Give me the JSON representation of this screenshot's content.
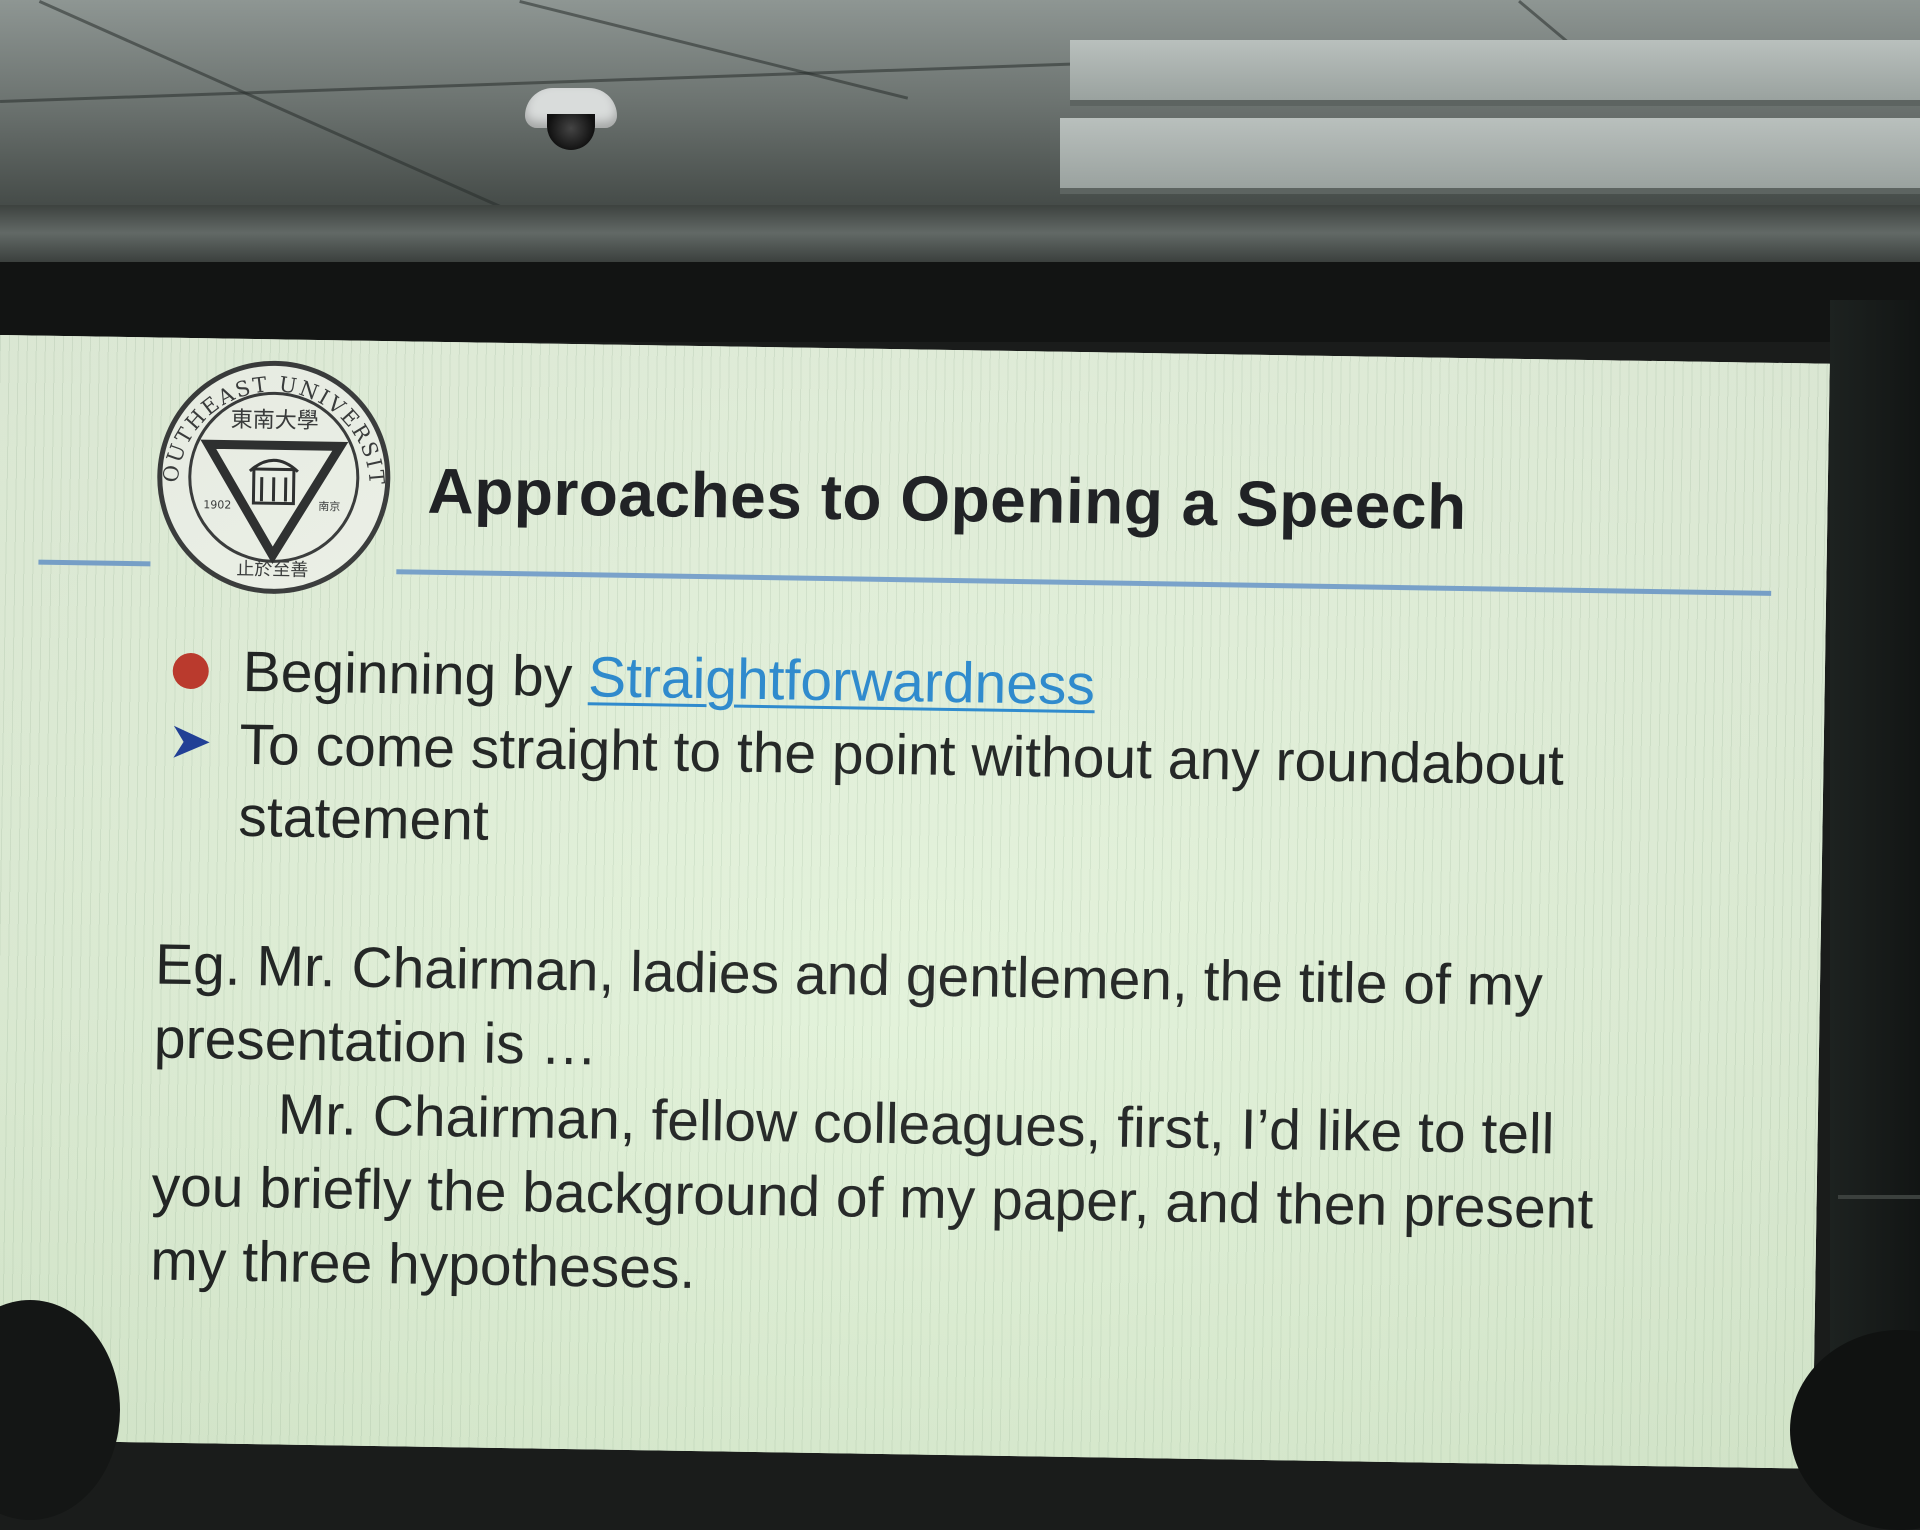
{
  "slide": {
    "title": "Approaches to Opening a Speech",
    "bullet": {
      "lead": "Beginning by ",
      "link": "Straightforwardness"
    },
    "sub_point": "To come straight to the point without any roundabout statement",
    "example": {
      "line1": "Eg. Mr. Chairman, ladies and gentlemen, the title of my presentation is …",
      "line2": "Mr. Chairman, fellow colleagues, first, I’d like to tell you briefly the background of my paper, and then present my three hypotheses."
    }
  },
  "logo": {
    "name": "SOUTHEAST UNIVERSITY",
    "chinese_name": "東南大學",
    "year": "1902",
    "city": "南京",
    "motto": "止於至善"
  },
  "colors": {
    "slide_background": "#e6f4dd",
    "title_text": "#1d1f22",
    "rule": "#7aa5cf",
    "bullet_dot": "#c0392b",
    "link": "#2a8ad0",
    "arrow": "#1f3f99"
  }
}
